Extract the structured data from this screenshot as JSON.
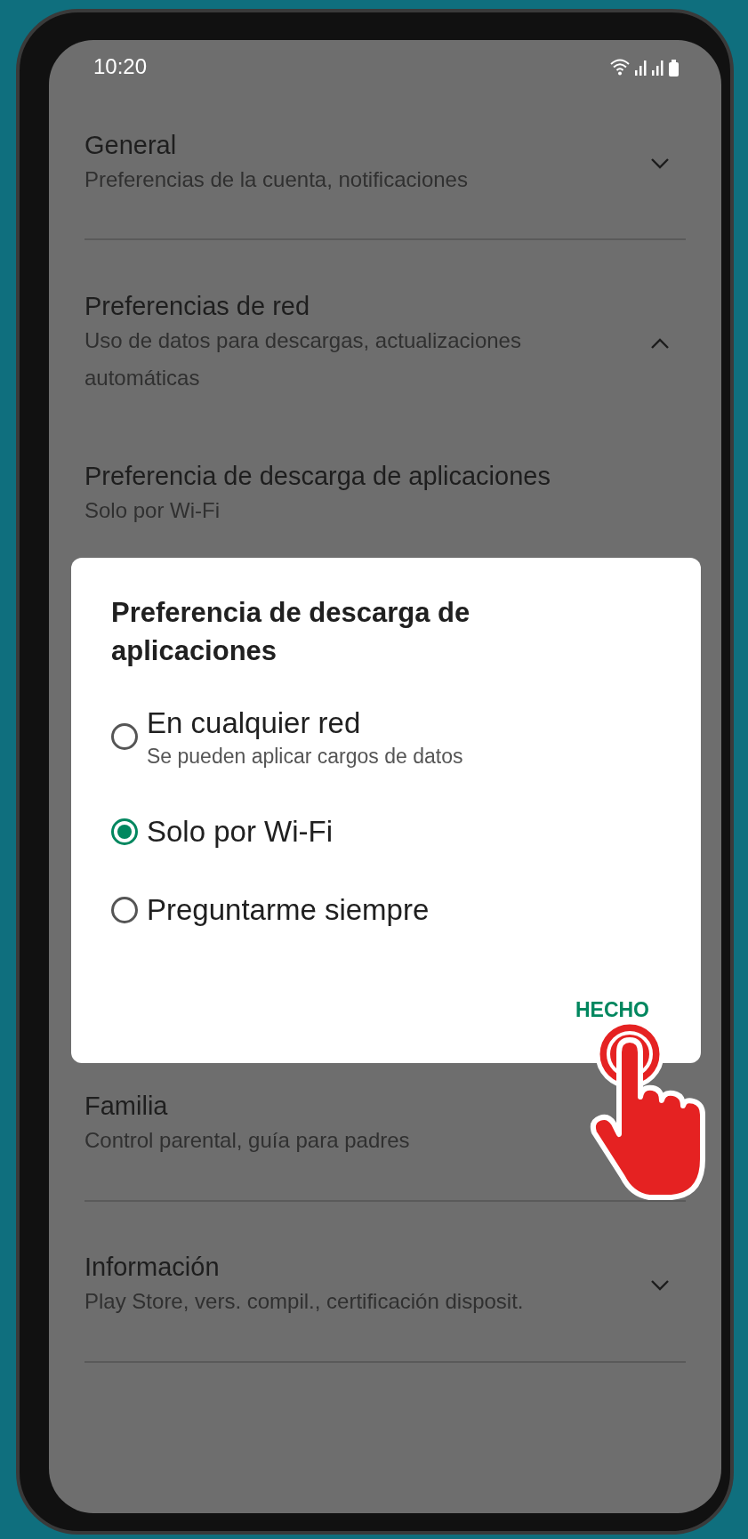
{
  "status_bar": {
    "time": "10:20"
  },
  "sections": [
    {
      "title": "General",
      "subtitle": "Preferencias de la cuenta, notificaciones",
      "expanded": false
    },
    {
      "title": "Preferencias de red",
      "subtitle": "Uso de datos para descargas, actualizaciones automáticas",
      "expanded": true,
      "children": [
        {
          "title": "Preferencia de descarga de aplicaciones",
          "subtitle": "Solo por Wi-Fi"
        }
      ]
    },
    {
      "title": "Familia",
      "subtitle": "Control parental, guía para padres"
    },
    {
      "title": "Información",
      "subtitle": "Play Store, vers. compil., certificación disposit.",
      "expanded": false
    }
  ],
  "dialog": {
    "title": "Preferencia de descarga de aplicaciones",
    "options": [
      {
        "label": "En cualquier red",
        "note": "Se pueden aplicar cargos de datos",
        "selected": false
      },
      {
        "label": "Solo por Wi-Fi",
        "selected": true
      },
      {
        "label": "Preguntarme siempre",
        "selected": false
      }
    ],
    "button": "HECHO"
  }
}
